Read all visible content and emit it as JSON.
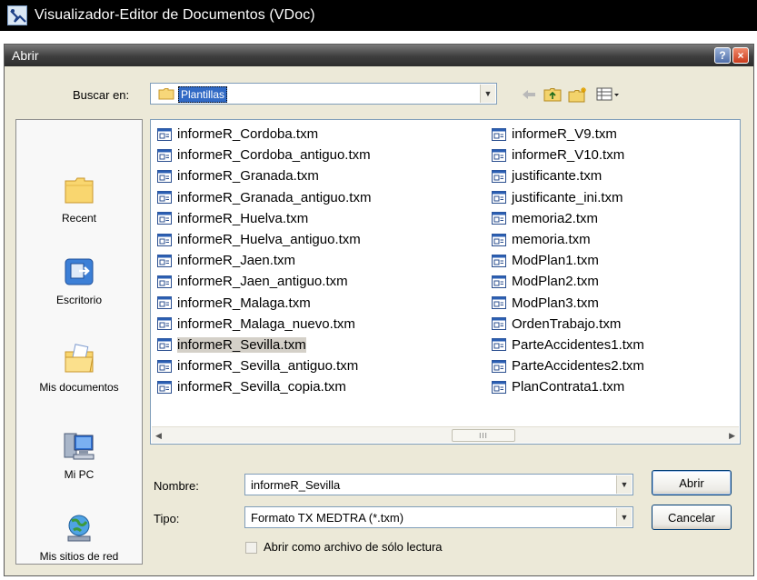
{
  "app": {
    "title": "Visualizador-Editor de Documentos (VDoc)"
  },
  "dialog": {
    "title": "Abrir",
    "help_label": "?",
    "close_label": "×",
    "lookin_label": "Buscar en:",
    "lookin_value": "Plantillas"
  },
  "places": [
    {
      "label": "Recent",
      "icon": "recent-folder-icon"
    },
    {
      "label": "Escritorio",
      "icon": "desktop-icon"
    },
    {
      "label": "Mis documentos",
      "icon": "my-documents-icon"
    },
    {
      "label": "Mi PC",
      "icon": "my-computer-icon"
    },
    {
      "label": "Mis sitios de red",
      "icon": "network-places-icon"
    }
  ],
  "files": {
    "column1": [
      "informeR_Cordoba.txm",
      "informeR_Cordoba_antiguo.txm",
      "informeR_Granada.txm",
      "informeR_Granada_antiguo.txm",
      "informeR_Huelva.txm",
      "informeR_Huelva_antiguo.txm",
      "informeR_Jaen.txm",
      "informeR_Jaen_antiguo.txm",
      "informeR_Malaga.txm",
      "informeR_Malaga_nuevo.txm",
      "informeR_Sevilla.txm",
      "informeR_Sevilla_antiguo.txm",
      "informeR_Sevilla_copia.txm"
    ],
    "column2": [
      "informeR_V9.txm",
      "informeR_V10.txm",
      "justificante.txm",
      "justificante_ini.txm",
      "memoria2.txm",
      "memoria.txm",
      "ModPlan1.txm",
      "ModPlan2.txm",
      "ModPlan3.txm",
      "OrdenTrabajo.txm",
      "ParteAccidentes1.txm",
      "ParteAccidentes2.txm",
      "PlanContrata1.txm"
    ],
    "selected": "informeR_Sevilla.txm"
  },
  "scrollbar": {
    "thumb_grip": "III"
  },
  "form": {
    "name_label": "Nombre:",
    "name_value": "informeR_Sevilla",
    "type_label": "Tipo:",
    "type_value": "Formato TX MEDTRA (*.txm)",
    "readonly_label": "Abrir como archivo de sólo lectura",
    "readonly_checked": false,
    "open_button": "Abrir",
    "cancel_button": "Cancelar"
  },
  "colors": {
    "app_titlebar": "#000000",
    "dialog_bg": "#ece9d8",
    "selection": "#316ac5",
    "field_border": "#7f9db9"
  }
}
